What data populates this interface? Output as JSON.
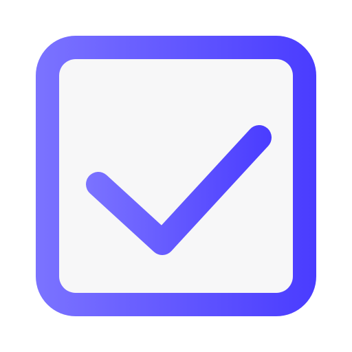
{
  "icon": {
    "name": "checkbox-checked-icon",
    "state": "checked"
  },
  "colors": {
    "gradient_start": "#7B73FF",
    "gradient_end": "#4A3CFF",
    "inner_fill": "#F7F7F8",
    "background": "#FFFFFF"
  }
}
